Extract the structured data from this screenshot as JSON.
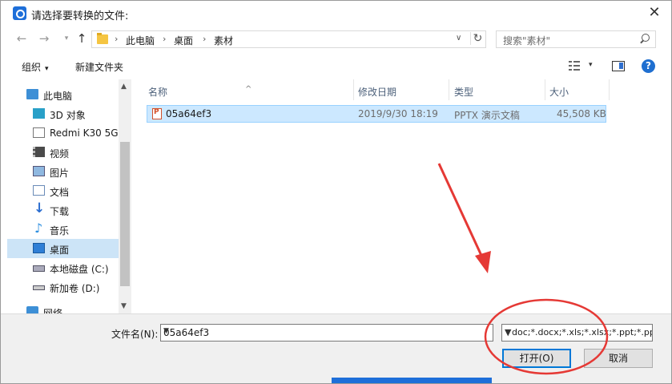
{
  "window": {
    "title": "请选择要转换的文件:",
    "close_glyph": "✕"
  },
  "nav": {
    "back": "←",
    "forward": "→",
    "recent": "▾",
    "up": "↑"
  },
  "address": {
    "crumbs": [
      "此电脑",
      "桌面",
      "素材"
    ],
    "separator": "›",
    "dropdown": "∨",
    "refresh": "↻"
  },
  "search": {
    "placeholder": "搜索\"素材\""
  },
  "toolbar": {
    "organize": "组织",
    "new_folder": "新建文件夹",
    "caret": "▾"
  },
  "sidebar": {
    "items": [
      {
        "label": "此电脑",
        "icon": "computer-icon"
      },
      {
        "label": "3D 对象",
        "icon": "3d-objects-icon"
      },
      {
        "label": "Redmi K30 5G",
        "icon": "phone-icon"
      },
      {
        "label": "视频",
        "icon": "video-icon"
      },
      {
        "label": "图片",
        "icon": "pictures-icon"
      },
      {
        "label": "文档",
        "icon": "documents-icon"
      },
      {
        "label": "下载",
        "icon": "download-icon"
      },
      {
        "label": "音乐",
        "icon": "music-icon"
      },
      {
        "label": "桌面",
        "icon": "desktop-icon",
        "selected": true
      },
      {
        "label": "本地磁盘 (C:)",
        "icon": "drive-icon"
      },
      {
        "label": "新加卷 (D:)",
        "icon": "drive-icon"
      },
      {
        "label": "网络",
        "icon": "network-icon"
      }
    ]
  },
  "filelist": {
    "columns": {
      "name": "名称",
      "modified": "修改日期",
      "type": "类型",
      "size": "大小"
    },
    "sort_glyph": "^",
    "rows": [
      {
        "name": "05a64ef3",
        "modified": "2019/9/30 18:19",
        "type": "PPTX 演示文稿",
        "size": "45,508 KB"
      }
    ]
  },
  "footer": {
    "filename_label": "文件名(N):",
    "filename_value": "05a64ef3",
    "filetype_value": "*.doc;*.docx;*.xls;*.xlsx;*.ppt;*.pptx",
    "open_button": "打开(O)",
    "cancel_button": "取消"
  },
  "colors": {
    "selection": "#cce8ff",
    "accent": "#0078d7",
    "annotation": "#e53935"
  }
}
